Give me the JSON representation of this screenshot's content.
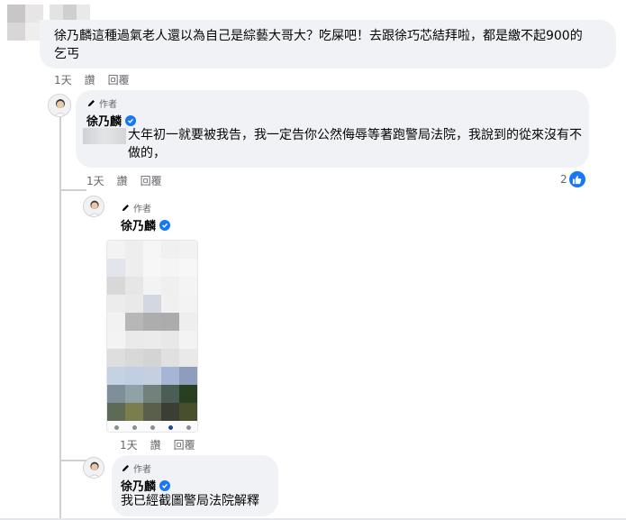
{
  "comment1": {
    "text": "徐乃麟這種過氣老人還以為自己是綜藝大哥大？吃屎吧！去跟徐巧芯結拜啦，都是繳不起900的乞丐",
    "time": "1天",
    "like_label": "讚",
    "reply_label": "回覆"
  },
  "reply1": {
    "author_tag": "作者",
    "name": "徐乃麟",
    "text": "大年初一就要被我告，我一定告你公然侮辱等著跑警局法院，我說到的從來沒有不做的，",
    "time": "1天",
    "like_label": "讚",
    "reply_label": "回覆",
    "reaction_count": "2"
  },
  "reply2": {
    "author_tag": "作者",
    "name": "徐乃麟",
    "time": "1天",
    "like_label": "讚",
    "reply_label": "回覆"
  },
  "reply3": {
    "author_tag": "作者",
    "name": "徐乃麟",
    "text": "我已經截圖警局法院解釋"
  },
  "colors": {
    "bubble": "#f0f2f5",
    "accent": "#1877f2",
    "meta": "#65676b"
  },
  "icons": [
    "pencil-icon",
    "verified-badge-icon",
    "like-icon"
  ]
}
